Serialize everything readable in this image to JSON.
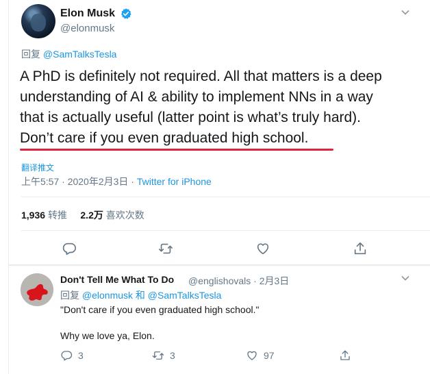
{
  "main_tweet": {
    "author_name": "Elon Musk",
    "handle": "@elonmusk",
    "reply_prefix": "回复",
    "reply_to": "@SamTalksTesla",
    "text_lines": [
      "A PhD is definitely not required. All that matters is a deep",
      "understanding of AI & ability to implement NNs in a way",
      "that is actually useful (latter point is what’s truly hard)."
    ],
    "highlight_line": "Don’t care if you even graduated high school.",
    "translate_label": "翻译推文",
    "timestamp": "上午5:57 · 2020年2月3日 ·",
    "source": "Twitter for iPhone",
    "retweet_count": "1,936",
    "retweet_label": "转推",
    "like_count": "2.2万",
    "like_label": "喜欢次数"
  },
  "reply_tweet": {
    "author_name": "Don't Tell Me What To Do",
    "handle": "@englishovals · 2月3日",
    "reply_prefix": "回复",
    "reply_to": "@elonmusk 和 @SamTalksTesla",
    "line1": "\"Don't care if you even graduated high school.\"",
    "line2": "Why we love ya, Elon.",
    "reply_count": "3",
    "retweet_count": "3",
    "like_count": "97"
  },
  "colors": {
    "link": "#1b95e0",
    "muted": "#657786",
    "text": "#14171a",
    "underline": "#e0223a"
  }
}
